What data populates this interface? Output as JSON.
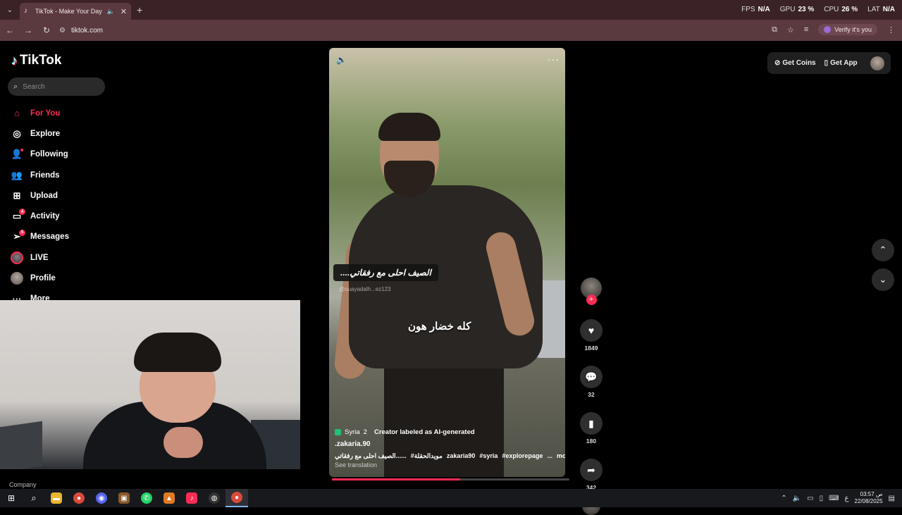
{
  "browser": {
    "tab_title": "TikTok - Make Your Day",
    "url": "tiktok.com",
    "verify_label": "Verify it's you",
    "stats": [
      {
        "label": "FPS",
        "value": "N/A"
      },
      {
        "label": "GPU",
        "value": "23 %"
      },
      {
        "label": "CPU",
        "value": "26 %"
      },
      {
        "label": "LAT",
        "value": "N/A"
      }
    ]
  },
  "sidebar": {
    "logo": "TikTok",
    "search_placeholder": "Search",
    "items": [
      {
        "label": "For You",
        "icon": "home-icon"
      },
      {
        "label": "Explore",
        "icon": "compass-icon"
      },
      {
        "label": "Following",
        "icon": "following-icon"
      },
      {
        "label": "Friends",
        "icon": "friends-icon"
      },
      {
        "label": "Upload",
        "icon": "upload-icon"
      },
      {
        "label": "Activity",
        "icon": "activity-icon",
        "badge": "4"
      },
      {
        "label": "Messages",
        "icon": "messages-icon",
        "badge": "5"
      },
      {
        "label": "LIVE",
        "icon": "live-avatar"
      },
      {
        "label": "Profile",
        "icon": "profile-avatar"
      },
      {
        "label": "More",
        "icon": "more-icon"
      }
    ],
    "footer": "Company"
  },
  "video": {
    "caption_top": "الصيف احلى مع رفقاتي....",
    "watermark": "@ouayadalh...ez123",
    "caption_mid": "كله خضار هون",
    "location": "Syria",
    "location_count": "2",
    "ai_label": "Creator labeled as AI-generated",
    "username": ".zakaria.90",
    "description_parts": [
      "الصيف احلى مع رفقاتي......",
      "#مويدالحقلة",
      "zakaria90",
      "#syria",
      "#explorepage",
      "..."
    ],
    "more_label": "more",
    "see_translation": "See translation",
    "progress": 0.54
  },
  "actions": {
    "likes": "1849",
    "comments": "32",
    "saves": "180",
    "shares": "342"
  },
  "topright": {
    "get_coins": "Get Coins",
    "get_app": "Get App"
  },
  "taskbar": {
    "time": "03:57 ص",
    "date": "22/08/2025",
    "lang": "ع"
  },
  "colors": {
    "accent": "#fe2c55",
    "tab_bar": "#3a2226",
    "toolbar": "#5a3a3f"
  }
}
